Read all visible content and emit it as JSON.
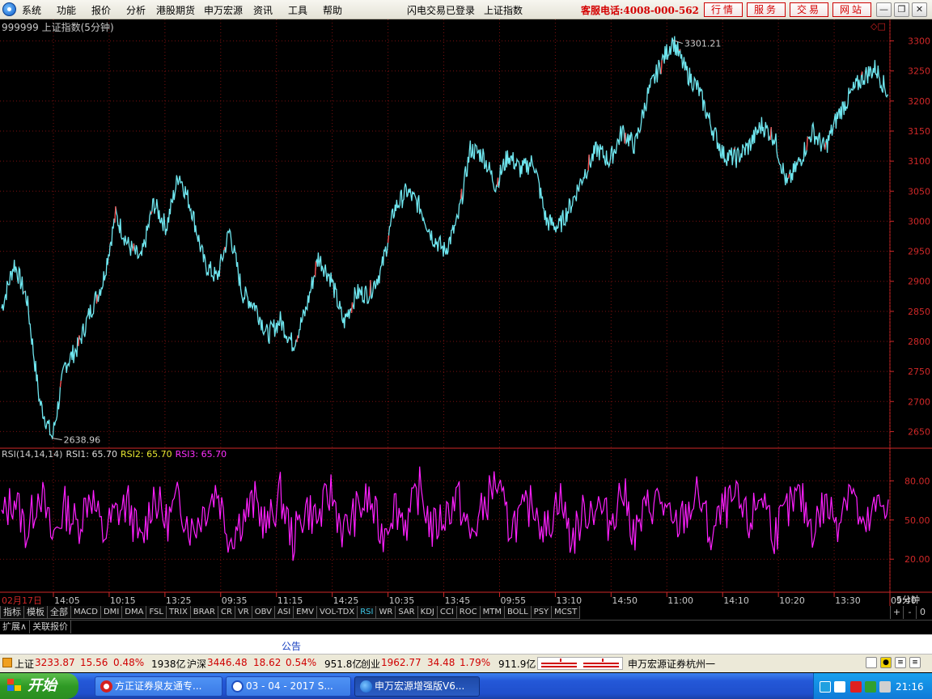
{
  "menu": {
    "items": [
      "系统",
      "功能",
      "报价",
      "分析",
      "港股期货",
      "申万宏源",
      "资讯",
      "工具",
      "帮助"
    ],
    "status": "闪电交易已登录",
    "title": "上证指数",
    "hotline": "客服电话:4008-000-562",
    "buttons": [
      "行情",
      "服务",
      "交易",
      "网站"
    ]
  },
  "window_controls": [
    "minimize",
    "restore",
    "close"
  ],
  "chart": {
    "header": "999999 上证指数(5分钟)",
    "max_label": "3301.21",
    "min_label": "2638.96",
    "date_tag": "02月17日",
    "period_tag": "5分钟",
    "price_ticks": [
      "3300",
      "3250",
      "3200",
      "3150",
      "3100",
      "3050",
      "3000",
      "2950",
      "2900",
      "2850",
      "2800",
      "2750",
      "2700",
      "2650"
    ],
    "time_ticks": [
      "14:05",
      "10:15",
      "13:25",
      "09:35",
      "11:15",
      "14:25",
      "10:35",
      "13:45",
      "09:55",
      "13:10",
      "14:50",
      "11:00",
      "14:10",
      "10:20",
      "13:30",
      "09:40"
    ],
    "rsi_legend": {
      "name": "RSI(14,14,14)",
      "rsi1": "RSI1: 65.70",
      "rsi2": "RSI2: 65.70",
      "rsi3": "RSI3: 65.70"
    },
    "rsi_ticks": [
      "80.00",
      "50.00",
      "20.00"
    ],
    "colors": {
      "price_line": "#6fe6ef",
      "up_tick": "#ff4040",
      "rsi_line": "#ff20ff",
      "axis": "#d02828",
      "grid": "#7a1010"
    }
  },
  "chart_data": [
    {
      "type": "line",
      "title": "999999 上证指数(5分钟)",
      "xlabel": "",
      "ylabel": "",
      "ylim": [
        2625,
        3325
      ],
      "x_ticks": [
        "14:05",
        "10:15",
        "13:25",
        "09:35",
        "11:15",
        "14:25",
        "10:35",
        "13:45",
        "09:55",
        "13:10",
        "14:50",
        "11:00",
        "14:10",
        "10:20",
        "13:30",
        "09:40"
      ],
      "series": [
        {
          "values": [
            2855,
            2930,
            2870,
            2700,
            2638.96,
            2760,
            2790,
            2850,
            2900,
            3010,
            2960,
            2935,
            3030,
            2990,
            3080,
            3020,
            2930,
            2905,
            2985,
            2880,
            2860,
            2810,
            2835,
            2795,
            2850,
            2940,
            2905,
            2830,
            2880,
            2880,
            2920,
            3020,
            3050,
            3025,
            2975,
            2950,
            3000,
            3120,
            3110,
            3060,
            3110,
            3085,
            3100,
            3000,
            2990,
            3030,
            3080,
            3120,
            3100,
            3150,
            3125,
            3210,
            3260,
            3301.21,
            3250,
            3220,
            3160,
            3110,
            3105,
            3125,
            3160,
            3140,
            3060,
            3100,
            3150,
            3120,
            3175,
            3210,
            3240,
            3255,
            3210
          ]
        },
        {
          "name": "RSI1",
          "values": [
            50,
            68,
            40,
            75,
            35,
            60,
            45,
            72,
            38,
            55,
            62,
            30,
            70,
            48,
            66,
            42,
            58,
            74,
            36,
            52,
            64,
            44,
            70,
            34,
            60,
            50,
            72,
            40,
            56,
            66,
            38,
            62,
            48,
            74,
            42,
            54,
            68,
            36,
            58,
            80,
            46,
            52,
            64,
            40,
            70,
            34,
            56,
            62,
            48,
            74,
            38,
            60,
            66,
            42,
            54,
            70,
            36,
            58,
            64,
            46,
            72,
            40,
            56,
            68,
            44,
            62,
            50,
            80,
            38,
            58,
            65.7
          ]
        }
      ],
      "extremes": {
        "max": 3301.21,
        "min": 2638.96
      }
    }
  ],
  "indicators": {
    "tabs": [
      "指标",
      "模板",
      "全部",
      "MACD",
      "DMI",
      "DMA",
      "FSL",
      "TRIX",
      "BRAR",
      "CR",
      "VR",
      "OBV",
      "ASI",
      "EMV",
      "VOL-TDX",
      "RSI",
      "WR",
      "SAR",
      "KDJ",
      "CCI",
      "ROC",
      "MTM",
      "BOLL",
      "PSY",
      "MCST"
    ],
    "active": "RSI",
    "controls": [
      "+",
      "-",
      "0"
    ]
  },
  "ext_tabs": [
    "扩展∧",
    "关联报价"
  ],
  "notice": "公告",
  "index_bar": {
    "sh": {
      "name": "上证",
      "value": "3233.87",
      "change": "15.56",
      "pct": "0.48%",
      "amount": "1938亿"
    },
    "hs": {
      "name": "沪深",
      "value": "3446.48",
      "change": "18.62",
      "pct": "0.54%",
      "amount": "951.8亿"
    },
    "cy": {
      "name": "创业",
      "value": "1962.77",
      "change": "34.48",
      "pct": "1.79%",
      "amount": "911.9亿"
    },
    "broker": "申万宏源证券杭州一"
  },
  "taskbar": {
    "start": "开始",
    "tasks": [
      "方正证券泉友通专...",
      "03 - 04 - 2017 S...",
      "申万宏源增强版V6..."
    ],
    "clock": "21:16"
  }
}
